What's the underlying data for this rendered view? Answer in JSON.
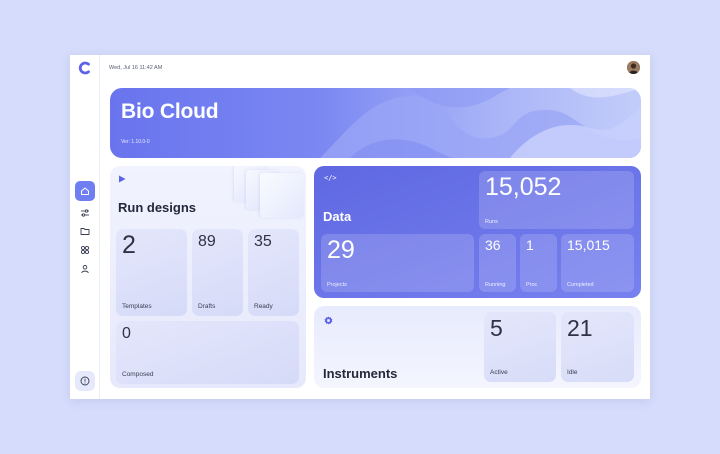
{
  "header": {
    "datetime": "Wed, Jul 16 11:42 AM",
    "avatar_icon": "user-avatar"
  },
  "sidebar": {
    "items": [
      {
        "icon": "home-icon",
        "active": true
      },
      {
        "icon": "sliders-icon",
        "active": false
      },
      {
        "icon": "folder-icon",
        "active": false
      },
      {
        "icon": "apps-grid-icon",
        "active": false
      },
      {
        "icon": "user-icon",
        "active": false
      }
    ],
    "footer_icon": "info-icon"
  },
  "hero": {
    "title": "Bio Cloud",
    "version": "Ver: 1.10.0-0"
  },
  "run_designs": {
    "title": "Run designs",
    "stats": [
      {
        "value": "2",
        "label": "Templates"
      },
      {
        "value": "89",
        "label": "Drafts"
      },
      {
        "value": "35",
        "label": "Ready"
      },
      {
        "value": "0",
        "label": "Composed"
      }
    ]
  },
  "data": {
    "title": "Data",
    "runs": {
      "value": "15,052",
      "label": "Runs"
    },
    "projects": {
      "value": "29",
      "label": "Projects"
    },
    "running": {
      "value": "36",
      "label": "Running"
    },
    "proc": {
      "value": "1",
      "label": "Proc"
    },
    "completed": {
      "value": "15,015",
      "label": "Completed"
    }
  },
  "instruments": {
    "title": "Instruments",
    "active": {
      "value": "5",
      "label": "Active"
    },
    "idle": {
      "value": "21",
      "label": "Idle"
    }
  },
  "colors": {
    "accent": "#6f7ef0",
    "data_panel": "#5f68e2",
    "background": "#d6dcfb"
  }
}
